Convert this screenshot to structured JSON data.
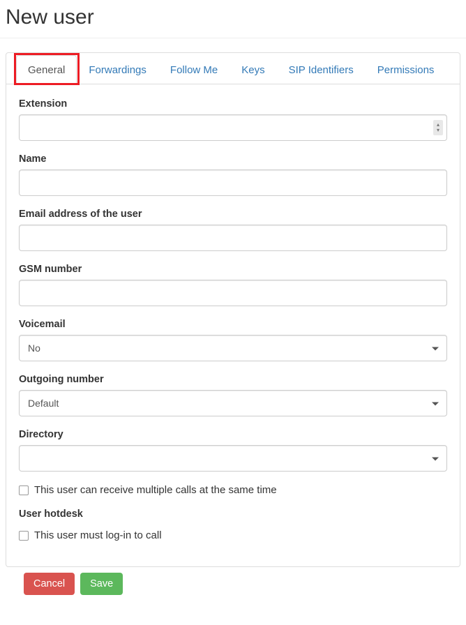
{
  "page_title": "New user",
  "tabs": [
    {
      "label": "General",
      "active": true
    },
    {
      "label": "Forwardings",
      "active": false
    },
    {
      "label": "Follow Me",
      "active": false
    },
    {
      "label": "Keys",
      "active": false
    },
    {
      "label": "SIP Identifiers",
      "active": false
    },
    {
      "label": "Permissions",
      "active": false
    }
  ],
  "form": {
    "extension": {
      "label": "Extension",
      "value": ""
    },
    "name": {
      "label": "Name",
      "value": ""
    },
    "email": {
      "label": "Email address of the user",
      "value": ""
    },
    "gsm": {
      "label": "GSM number",
      "value": ""
    },
    "voicemail": {
      "label": "Voicemail",
      "value": "No"
    },
    "outgoing_number": {
      "label": "Outgoing number",
      "value": "Default"
    },
    "directory": {
      "label": "Directory",
      "value": ""
    },
    "multi_calls": {
      "label": "This user can receive multiple calls at the same time",
      "checked": false
    },
    "hotdesk_section": "User hotdesk",
    "must_login": {
      "label": "This user must log-in to call",
      "checked": false
    }
  },
  "buttons": {
    "cancel": "Cancel",
    "save": "Save"
  }
}
